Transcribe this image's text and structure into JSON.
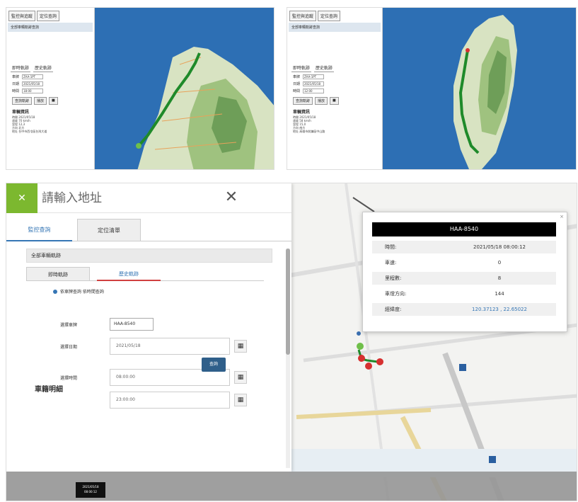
{
  "top_left": {
    "tabs": [
      "監控與追蹤",
      "定位查詢"
    ],
    "banner": "全部車輛軌跡查詢",
    "subtabs": [
      "即時軌跡",
      "歷史軌跡"
    ],
    "form": [
      {
        "label": "車牌",
        "value": "ZAA-1PT"
      },
      {
        "label": "日期",
        "value": "2021/05/18"
      },
      {
        "label": "時間",
        "value": "18:00"
      }
    ],
    "buttons": [
      "查詢軌跡",
      "播放",
      "■"
    ],
    "info_title": "車輛資訊",
    "info_lines": [
      "時間 2021/05/18",
      "速度 70 km/h",
      "里程 12,3",
      "方向 北方",
      "地址 台中市西屯區台灣大道"
    ]
  },
  "top_right": {
    "tabs": [
      "監控與追蹤",
      "定位查詢"
    ],
    "banner": "全部車輛軌跡查詢",
    "subtabs": [
      "即時軌跡",
      "歷史軌跡"
    ],
    "form": [
      {
        "label": "車牌",
        "value": "ZAA-1PT"
      },
      {
        "label": "日期",
        "value": "2021/05/18"
      },
      {
        "label": "時間",
        "value": "12:00"
      }
    ],
    "buttons": [
      "查詢軌跡",
      "播放",
      "■"
    ],
    "info_title": "車輛資訊",
    "info_lines": [
      "時間 2021/05/18",
      "速度 58 km/h",
      "里程 15,0",
      "方向 南方",
      "地址 高雄市前鎮區中山路"
    ]
  },
  "main": {
    "search_placeholder": "請輸入地址",
    "close_glyph": "✕",
    "green_glyph": "✕",
    "tabs": [
      "監控查詢",
      "定位清單"
    ],
    "banner": "全部車輛軌跡",
    "subtabs": [
      "即時軌跡",
      "歷史軌跡"
    ],
    "radio_label": "依車牌查詢  依時間查詢",
    "plate_label": "選擇車牌",
    "plate_value": "HAA-8540",
    "date_label": "選擇日期",
    "date_value": "2021/05/18",
    "time_label": "選擇時間",
    "time_start": "08:00:00",
    "time_end": "23:00:00",
    "calendar_glyph": "▦",
    "query_button": "查詢",
    "info_title": "車籍明細"
  },
  "popup": {
    "close": "×",
    "title": "HAA-8540",
    "rows": [
      {
        "key": "時間:",
        "value": "2021/05/18 08:00:12"
      },
      {
        "key": "車速:",
        "value": "0"
      },
      {
        "key": "里程數:",
        "value": "8"
      },
      {
        "key": "車燈方向:",
        "value": "144"
      },
      {
        "key": "經緯度:",
        "value": "120.37123 , 22.65022",
        "link": true
      }
    ]
  },
  "bottom_tip": [
    "2021/05/18",
    "08:00:12"
  ],
  "colors": {
    "accent_green": "#7cb82f",
    "accent_blue": "#3576b5",
    "route_green": "#1f8a2a",
    "query_button": "#2f5f8a",
    "marker_red": "#d63030"
  }
}
